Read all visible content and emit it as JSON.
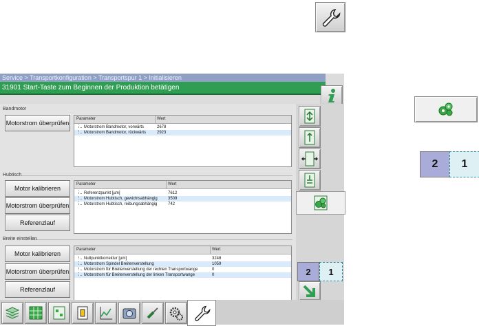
{
  "breadcrumb": "Service > Transportkonfiguration > Transportspur 1 > Initialisieren",
  "message": "31901 Start-Taste zum Beginnen der Produktion betätigen",
  "sections": {
    "bandmotor": {
      "label": "Bandmotor",
      "button": "Motorstrom überprüfen",
      "headers": [
        "Parameter",
        "Wert"
      ],
      "rows": [
        {
          "param": "Motorstrom Bandmotor, vorwärts",
          "value": "2678"
        },
        {
          "param": "Motorstrom Bandmotor, rückwärts",
          "value": "2923"
        }
      ]
    },
    "hubtisch": {
      "label": "Hubtisch",
      "buttons": [
        "Motor kalibrieren",
        "Motorstrom überprüfen",
        "Referenzlauf"
      ],
      "headers": [
        "Parameter",
        "Wert"
      ],
      "rows": [
        {
          "param": "Referenzpunkt [µm]",
          "value": "7612"
        },
        {
          "param": "Motorstrom Hubtisch, gewichtsabhängig",
          "value": "3509"
        },
        {
          "param": "Motorstrom Hubtisch, reibungsabhängig",
          "value": "742"
        }
      ]
    },
    "breite": {
      "label": "Breite einstellen",
      "buttons": [
        "Motor kalibrieren",
        "Motorstrom überprüfen",
        "Referenzlauf"
      ],
      "headers": [
        "Parameter",
        "Wert"
      ],
      "rows": [
        {
          "param": "Nullpunktkorrektur [µm]",
          "value": "3248"
        },
        {
          "param": "Motorstrom Spindel Breitenverstellung",
          "value": "1059"
        },
        {
          "param": "Motorstrom für Breitenverstellung der rechten Transportwange",
          "value": "0"
        },
        {
          "param": "Motorstrom für Breitenverstellung der linken Transportwange",
          "value": "0"
        }
      ]
    }
  },
  "lane_toggle": {
    "lane2": "2",
    "lane1": "1"
  },
  "external_toggle": {
    "lane2": "2",
    "lane1": "1"
  },
  "icons": {
    "service": "wrench-icon",
    "info": "info-icon",
    "gear_green": "gears-icon",
    "nav_next": "arrow-icon"
  },
  "colors": {
    "breadcrumb_bg": "#8fa0c4",
    "message_bg": "#2f9e53",
    "selected_row": "#d9eafb",
    "lane2_bg": "#a9acd9",
    "lane1_bg": "#dff0f4"
  }
}
